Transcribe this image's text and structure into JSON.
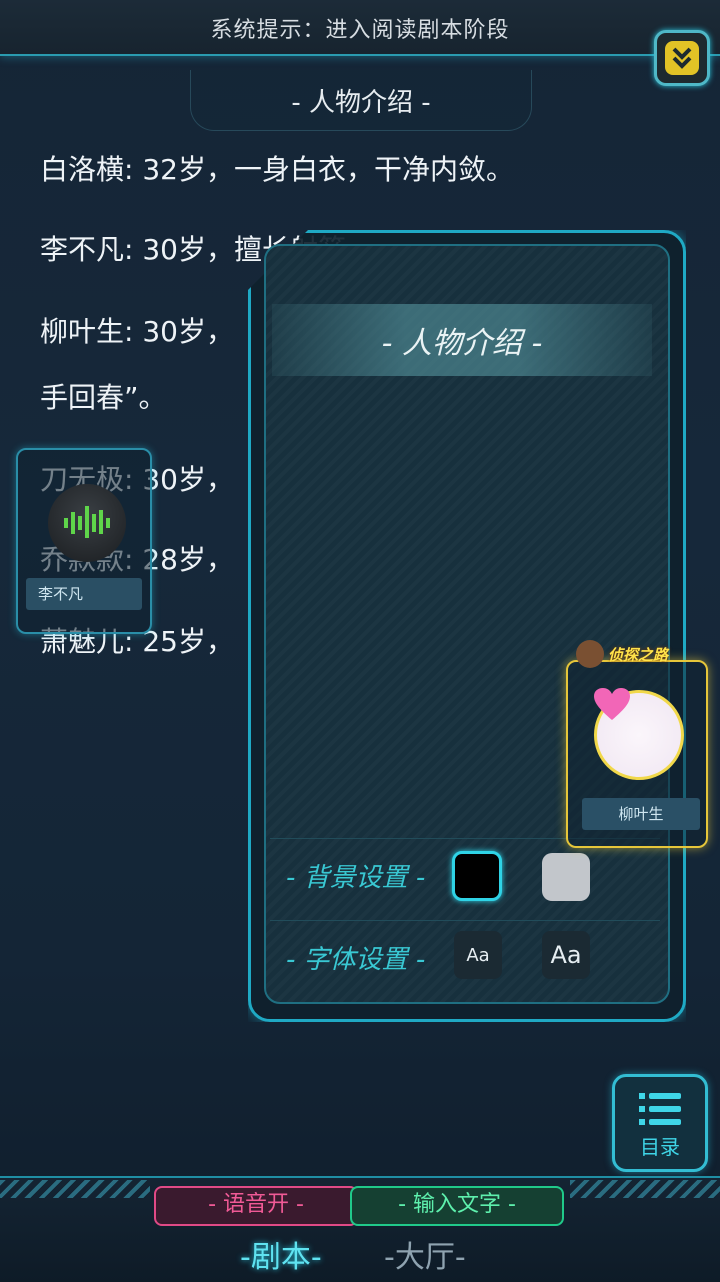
{
  "system_prompt": "系统提示：进入阅读剧本阶段",
  "section_title": "- 人物介绍 -",
  "intro_lines": [
    "白洛横: 32岁，一身白衣，干净内敛。",
    "李不凡: 30岁，擅长射箭，",
    "柳叶生: 30岁，",
    "手回春”。",
    "刀无极: 30岁，",
    "乔款款: 28岁，",
    "萧魅儿: 25岁，"
  ],
  "left_player": {
    "name": "李不凡"
  },
  "right_player": {
    "name": "柳叶生",
    "banner": "侦探之路"
  },
  "panel": {
    "title": "- 人物介绍 -",
    "bg_setting_label": "- 背景设置 -",
    "font_setting_label": "- 字体设置 -",
    "font_small": "Aa",
    "font_large": "Aa",
    "bg_colors": [
      "#000000",
      "#c2c6cb"
    ]
  },
  "menu": {
    "label": "目录"
  },
  "bottom": {
    "voice": "- 语音开 -",
    "input": "- 输入文字 -",
    "tabs": [
      "-剧本-",
      "-大厅-"
    ]
  },
  "colors": {
    "accent": "#1fa9c4",
    "voice": "#e04a86",
    "input": "#20c98a",
    "highlight": "#e2c326"
  }
}
